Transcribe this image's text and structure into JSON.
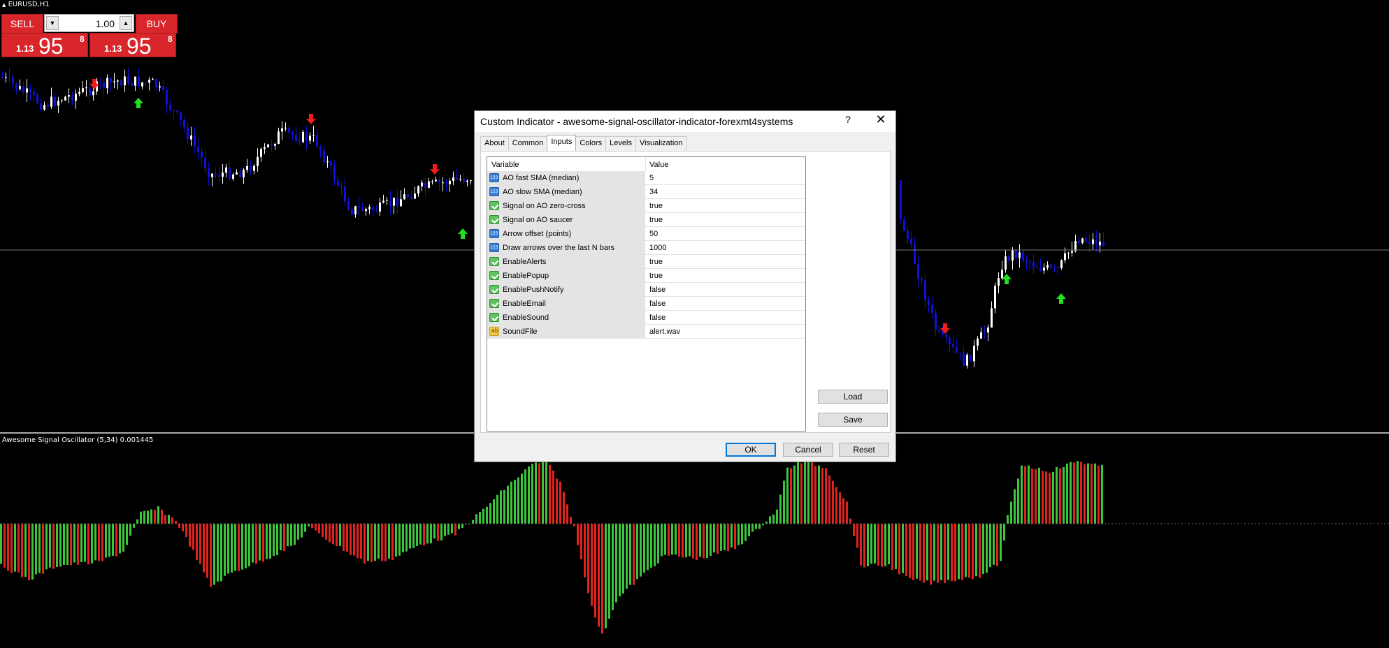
{
  "window": {
    "symbol_title": "EURUSD,H1"
  },
  "trade_panel": {
    "sell_label": "SELL",
    "buy_label": "BUY",
    "lot_value": "1.00",
    "sell_price": {
      "prefix": "1.13",
      "big": "95",
      "pip": "8"
    },
    "buy_price": {
      "prefix": "1.13",
      "big": "95",
      "pip": "8"
    }
  },
  "oscillator_label": "Awesome Signal Oscillator (5,34) 0.001445",
  "dialog": {
    "title": "Custom Indicator - awesome-signal-oscillator-indicator-forexmt4systems",
    "help_label": "?",
    "close_label": "✕",
    "tabs": [
      "About",
      "Common",
      "Inputs",
      "Colors",
      "Levels",
      "Visualization"
    ],
    "active_tab": "Inputs",
    "table_headers": {
      "variable": "Variable",
      "value": "Value"
    },
    "rows": [
      {
        "name": "AO fast SMA (median)",
        "value": "5",
        "icon": "number-icon"
      },
      {
        "name": "AO slow SMA (median)",
        "value": "34",
        "icon": "number-icon"
      },
      {
        "name": "Signal on AO zero-cross",
        "value": "true",
        "icon": "boolean-icon"
      },
      {
        "name": "Signal on AO saucer",
        "value": "true",
        "icon": "boolean-icon"
      },
      {
        "name": "Arrow offset (points)",
        "value": "50",
        "icon": "number-icon"
      },
      {
        "name": "Draw arrows over the last N bars",
        "value": "1000",
        "icon": "number-icon"
      },
      {
        "name": "EnableAlerts",
        "value": "true",
        "icon": "boolean-icon"
      },
      {
        "name": "EnablePopup",
        "value": "true",
        "icon": "boolean-icon"
      },
      {
        "name": "EnablePushNotify",
        "value": "false",
        "icon": "boolean-icon"
      },
      {
        "name": "EnableEmail",
        "value": "false",
        "icon": "boolean-icon"
      },
      {
        "name": "EnableSound",
        "value": "false",
        "icon": "boolean-icon"
      },
      {
        "name": "SoundFile",
        "value": "alert.wav",
        "icon": "string-icon"
      }
    ],
    "load_label": "Load",
    "save_label": "Save",
    "ok_label": "OK",
    "cancel_label": "Cancel",
    "reset_label": "Reset"
  },
  "colors": {
    "bull_candle": "#ffffff",
    "bear_candle": "#1010d8",
    "osc_up": "#3cc63c",
    "osc_down": "#e0231f",
    "sell_button": "#d9262b",
    "arrow_buy": "#22dd22",
    "arrow_sell": "#ee1c1c"
  },
  "arrow_labels": {
    "buy": "BUY",
    "sell": "SELL"
  }
}
